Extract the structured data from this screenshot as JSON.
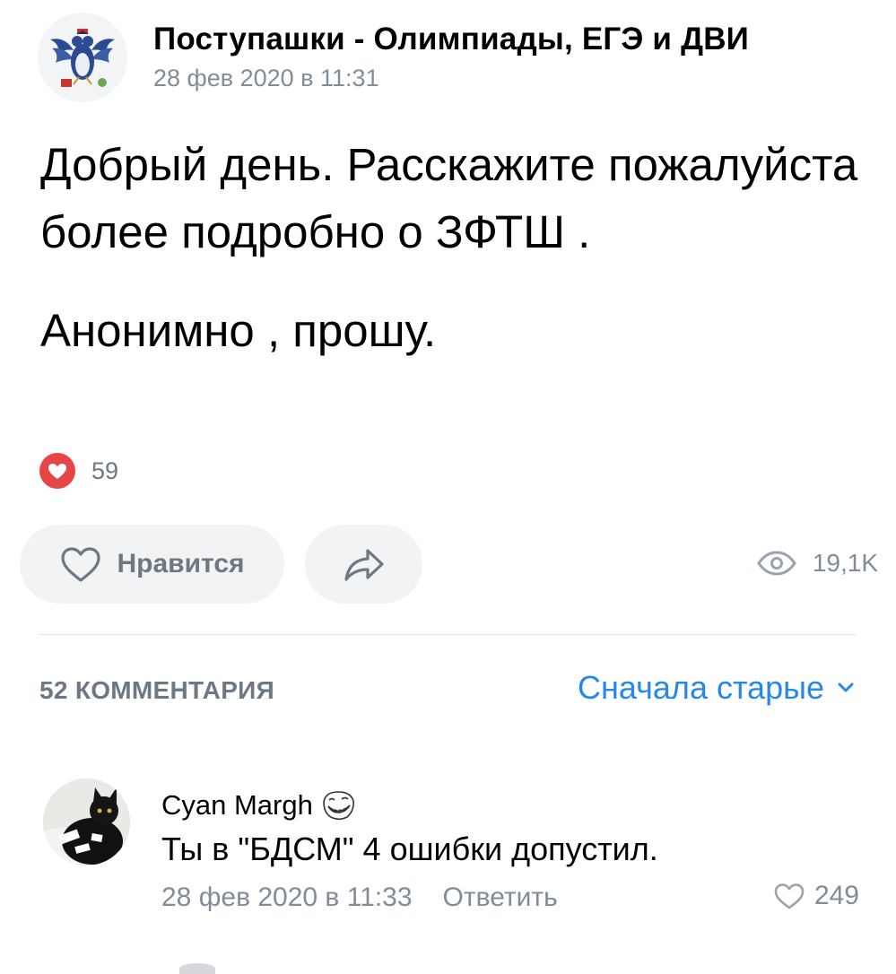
{
  "post": {
    "group_name": "Поступашки - Олимпиады, ЕГЭ и ДВИ",
    "date": "28 фев 2020 в 11:31",
    "avatar_icon": "eagle-emblem-icon",
    "text_paragraph_1": "Добрый день. Расскажите пожалуйста более подробно о ЗФТШ .",
    "text_paragraph_2": "Анонимно , прошу.",
    "reaction_count": "59",
    "reaction_icon": "heart-icon",
    "like_button_label": "Нравится",
    "share_icon": "share-arrow-icon",
    "views_icon": "eye-icon",
    "views_count": "19,1K"
  },
  "comments_section": {
    "count_label": "52 КОММЕНТАРИЯ",
    "sort_label": "Сначала старые",
    "sort_icon": "chevron-down-icon"
  },
  "comments": [
    {
      "author": "Cyan Margh",
      "author_emoji": "trollface-icon",
      "text": "Ты в \"БДСМ\" 4 ошибки допустил.",
      "date": "28 фев 2020 в 11:33",
      "reply_label": "Ответить",
      "likes": "249"
    }
  ],
  "colors": {
    "accent": "#2688eb",
    "secondary_text": "#818c99",
    "button_bg": "#f2f3f5",
    "reaction_red": "#e64646"
  }
}
